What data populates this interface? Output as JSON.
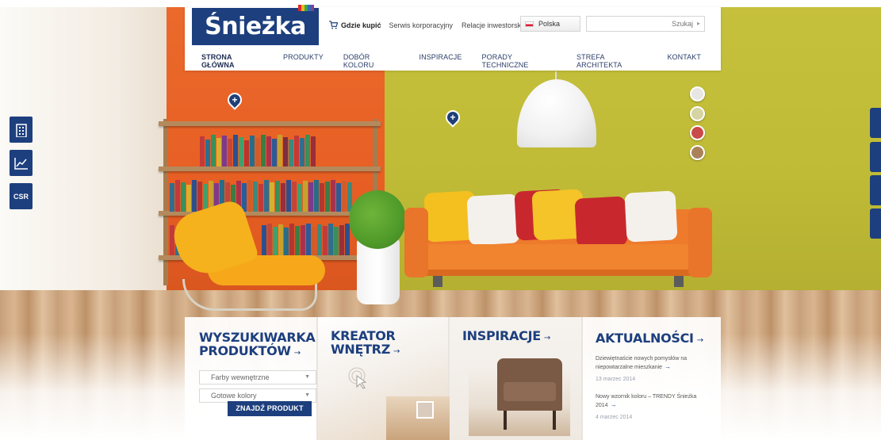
{
  "logo": {
    "text": "Śnieżka"
  },
  "topbar": {
    "where_to_buy": "Gdzie kupić",
    "corporate_service": "Serwis korporacyjny",
    "investor_relations": "Relacje inwestorskie",
    "language": "Polska",
    "search_placeholder": "Szukaj"
  },
  "nav": {
    "items": [
      {
        "label": "STRONA GŁÓWNA",
        "active": true
      },
      {
        "label": "PRODUKTY"
      },
      {
        "label": "DOBÓR KOLORU"
      },
      {
        "label": "INSPIRACJE"
      },
      {
        "label": "PORADY TECHNICZNE"
      },
      {
        "label": "STREFA ARCHITEKTA"
      },
      {
        "label": "KONTAKT"
      }
    ]
  },
  "side_left": {
    "csr_label": "CSR"
  },
  "swatches": [
    "#e8e6e3",
    "#d5d4a2",
    "#c94a48",
    "#a9825a"
  ],
  "colors": {
    "brand_blue": "#1d3f7e",
    "orange_wall": "#e8632a",
    "green_wall": "#bfbb36"
  },
  "tiles": {
    "product_search": {
      "title_line1": "WYSZUKIWARKA",
      "title_line2": "PRODUKTÓW",
      "select1": "Farby wewnętrzne",
      "select2": "Gotowe kolory",
      "button": "ZNAJDŹ PRODUKT"
    },
    "interior_creator": {
      "title_line1": "KREATOR",
      "title_line2": "WNĘTRZ"
    },
    "inspirations": {
      "title": "INSPIRACJE"
    },
    "news": {
      "title": "AKTUALNOŚCI",
      "items": [
        {
          "text": "Dziewiętnaście nowych pomysłów na niepowtarzalne mieszkanie",
          "date": "13 marzec 2014"
        },
        {
          "text": "Nowy wzornik koloru – TRENDY Śnieżka 2014",
          "date": "4 marzec 2014"
        }
      ]
    }
  }
}
